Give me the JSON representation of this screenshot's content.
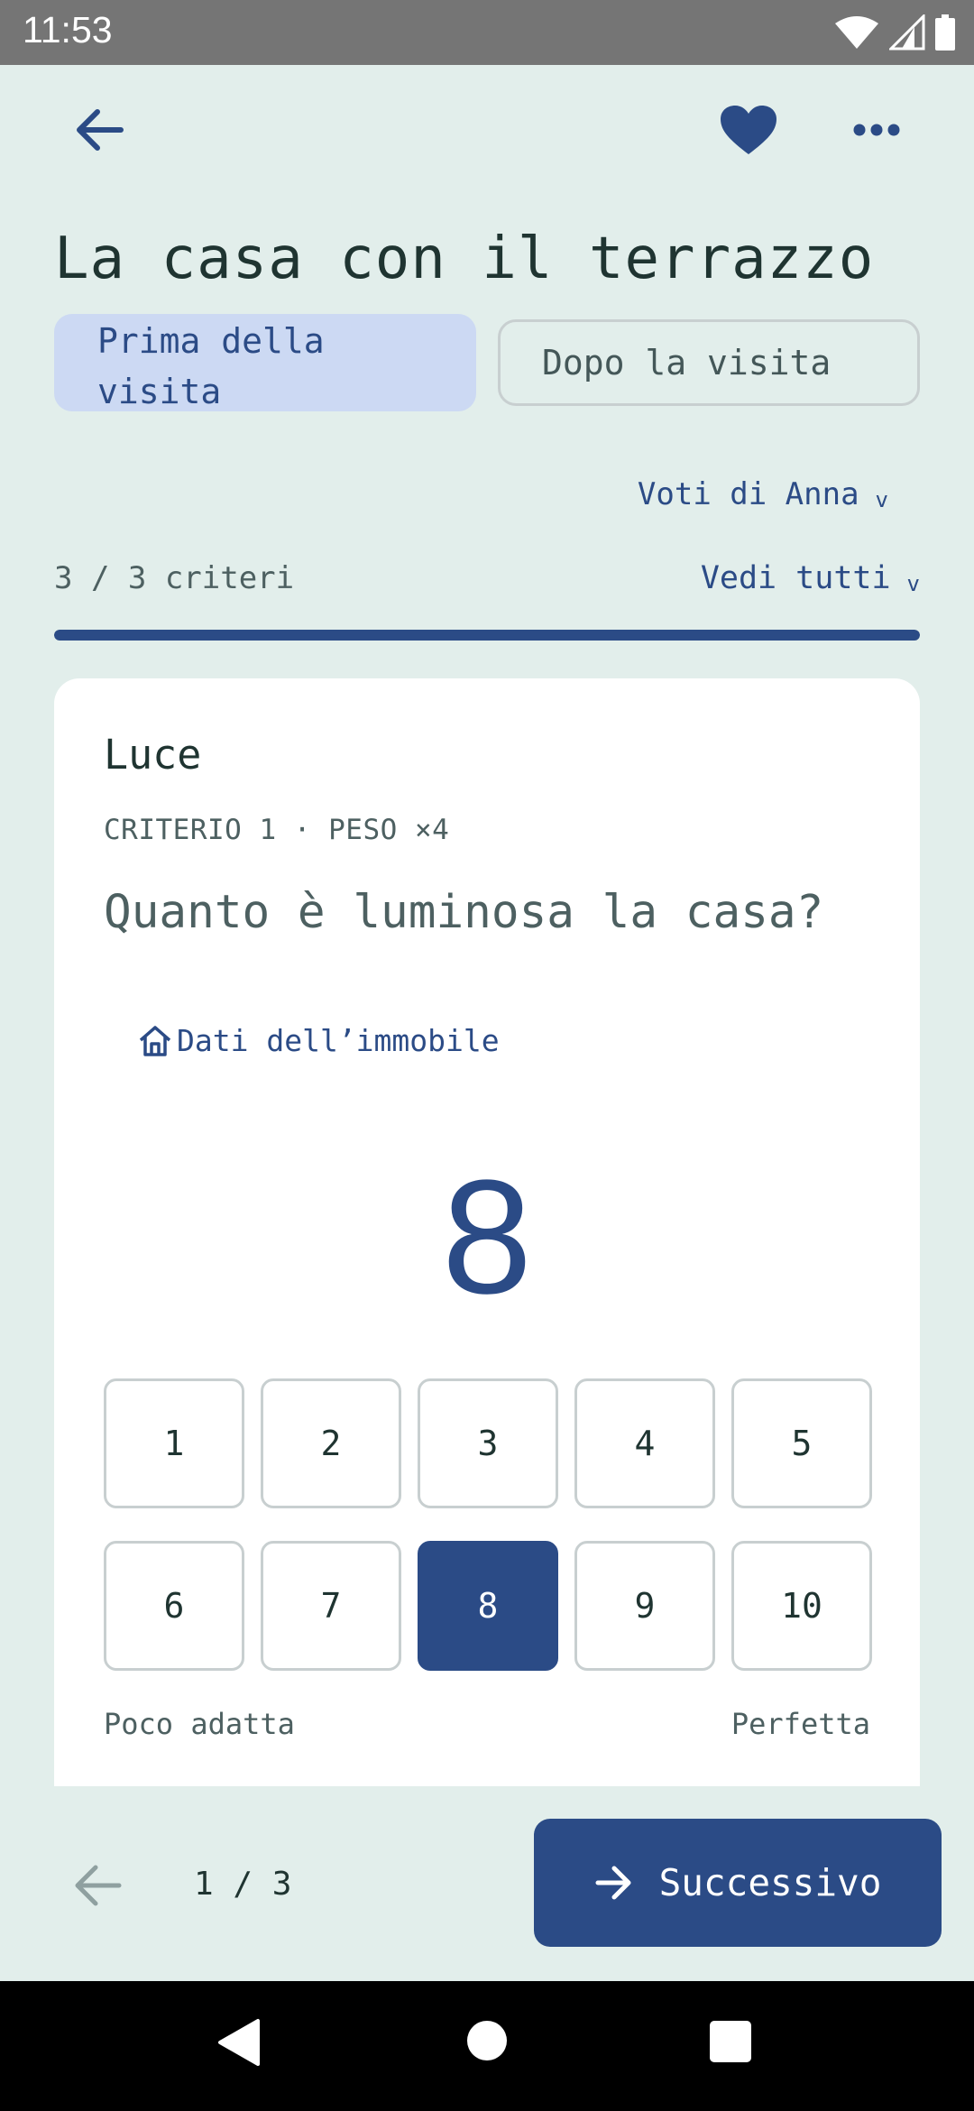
{
  "status_bar": {
    "time": "11:53"
  },
  "header": {
    "title": "La casa con il terrazzo"
  },
  "tabs": [
    {
      "label": "Prima della visita",
      "selected": true
    },
    {
      "label": "Dopo la visita",
      "selected": false
    }
  ],
  "voti": {
    "label": "Voti di Anna",
    "caret": "v"
  },
  "criteria": {
    "count_label": "3 / 3 criteri",
    "see_all_label": "Vedi tutti",
    "caret": "v",
    "progress": 1.0
  },
  "card": {
    "name": "Luce",
    "meta": "CRITERIO 1 · PESO ×4",
    "question": "Quanto è luminosa la casa?",
    "property_link": "Dati dell’immobile",
    "selected_score": "8",
    "scale_min_label": "Poco adatta",
    "scale_max_label": "Perfetta"
  },
  "scores": [
    "1",
    "2",
    "3",
    "4",
    "5",
    "6",
    "7",
    "8",
    "9",
    "10"
  ],
  "footer": {
    "pager": "1 / 3",
    "next_label": "Successivo"
  },
  "colors": {
    "accent": "#2b4b86",
    "background": "#e2eeeb",
    "tab_selected_bg": "#ccd9f3"
  }
}
